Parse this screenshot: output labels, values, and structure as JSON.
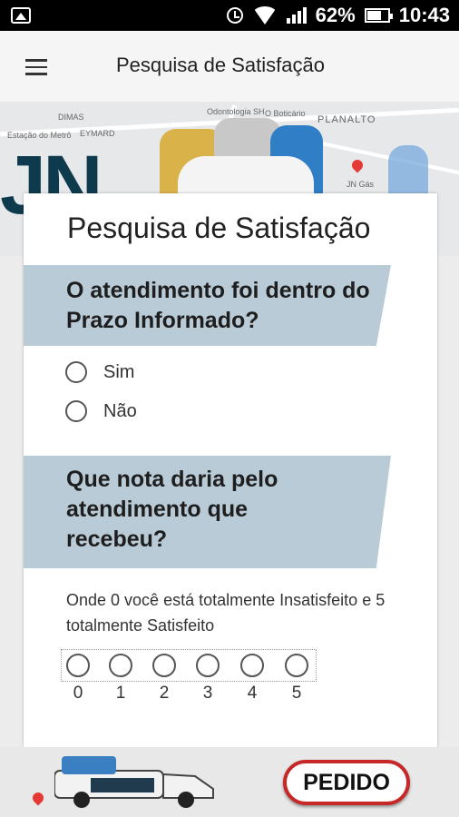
{
  "status_bar": {
    "battery": "62%",
    "time": "10:43"
  },
  "app_bar": {
    "title": "Pesquisa de Satisfação"
  },
  "banner": {
    "map_labels": [
      "DIMAS",
      "EYMARD",
      "Estação do Metrô",
      "Odontologia SH",
      "O Boticário",
      "PLANALTO",
      "JN Gás"
    ],
    "logo_text": "JN"
  },
  "survey": {
    "title": "Pesquisa de Satisfação",
    "question1": {
      "text": "O atendimento foi dentro do Prazo Informado?",
      "options": [
        "Sim",
        "Não"
      ]
    },
    "question2": {
      "text": "Que nota daria pelo atendimento que recebeu?",
      "hint": "Onde 0 você está totalmente Insatisfeito e 5 totalmente Satisfeito",
      "scale": [
        "0",
        "1",
        "2",
        "3",
        "4",
        "5"
      ]
    }
  },
  "footer": {
    "order_button": "PEDIDO"
  },
  "colors": {
    "question_band": "#b9cbd6",
    "order_button_border": "#c62828",
    "logo": "#0e3a4e"
  }
}
